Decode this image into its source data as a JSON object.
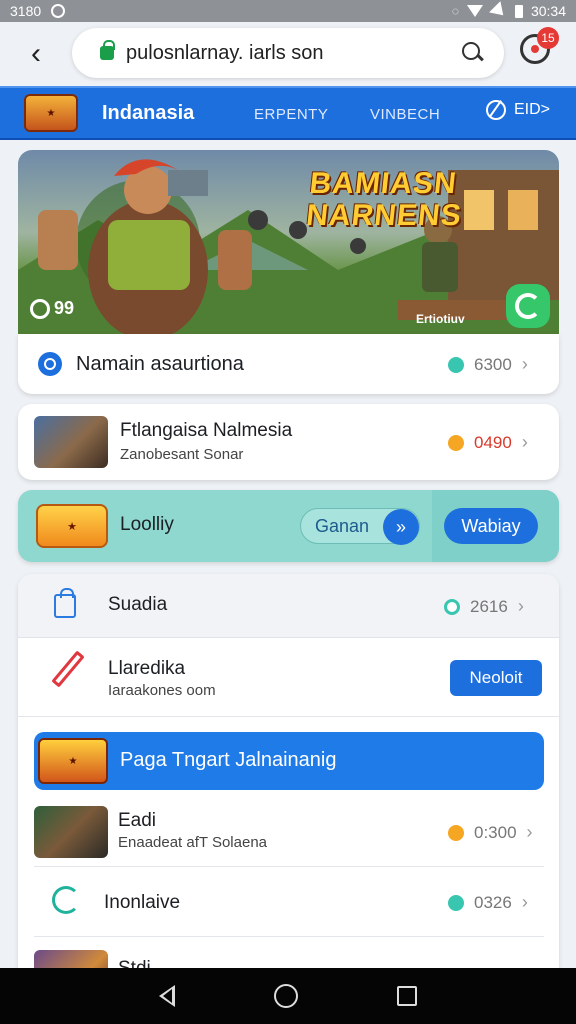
{
  "status_bar": {
    "time_left": "3180",
    "time_right": "30:34"
  },
  "browser": {
    "url": "pulosnlarnay. iarls son",
    "notification_count": "15"
  },
  "nav": {
    "title": "Indanasia",
    "links": [
      "ERPENTY",
      "VINBECH"
    ],
    "exit_label": "EID>"
  },
  "banner": {
    "title_line1": "BAMIASN",
    "title_line2": "NARNENS",
    "count": "99",
    "caption": "Ertiotiuv"
  },
  "rows": {
    "info": {
      "title": "Namain asaurtiona",
      "value": "6300",
      "dot_color": "#39c6b0"
    },
    "game1": {
      "title": "Ftlangaisa Nalmesia",
      "subtitle": "Zanobesant Sonar",
      "value": "0490",
      "dot_color": "#f5a623",
      "value_color": "#d83a2c"
    },
    "promo": {
      "label": "Loolliy",
      "pill_label": "Ganan",
      "button_label": "Wabiay"
    },
    "suadia": {
      "title": "Suadia",
      "value": "2616"
    },
    "edit": {
      "title": "Llaredika",
      "subtitle": "Iaraakones oom",
      "button_label": "Neoloit"
    },
    "banner_row": {
      "label": "Paga Tngart Jalnainanig"
    },
    "game2": {
      "title": "Eadi",
      "subtitle": "Enaadeat afT Solaena",
      "value": "0:300",
      "dot_color": "#f5a623"
    },
    "loading": {
      "title": "Inonlaive",
      "value": "0326",
      "dot_color": "#39c6b0"
    },
    "partial": {
      "title": "Stdi"
    }
  }
}
